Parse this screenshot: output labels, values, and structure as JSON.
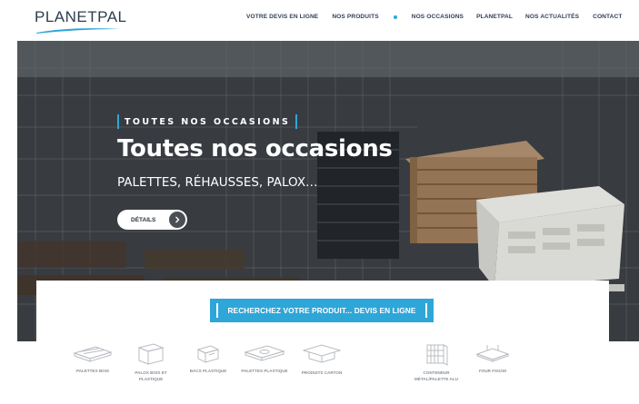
{
  "header": {
    "logo_text": "PLANETPAL",
    "nav": [
      {
        "label": "VOTRE DEVIS EN LIGNE"
      },
      {
        "label": "NOS PRODUITS"
      },
      {
        "label": "NOS OCCASIONS"
      },
      {
        "label": "PLANETPAL"
      },
      {
        "label": "NOS ACTUALITÉS"
      },
      {
        "label": "CONTACT"
      }
    ]
  },
  "hero": {
    "kicker": "TOUTES NOS OCCASIONS",
    "title": "Toutes nos occasions",
    "subtitle": "PALETTES, RÉHAUSSES, PALOX…",
    "button_label": "DÉTAILS",
    "button_icon": "chevron-right-icon"
  },
  "cta": {
    "label": "RECHERCHEZ VOTRE PRODUIT... DEVIS EN LIGNE"
  },
  "products": [
    {
      "label": "PALETTES BOIS",
      "icon": "wood-pallet-icon"
    },
    {
      "label": "PALOX BOIS ET PLASTIQUE",
      "icon": "palox-icon"
    },
    {
      "label": "BACS PLASTIQUE",
      "icon": "plastic-bin-icon"
    },
    {
      "label": "PALETTES PLASTIQUE",
      "icon": "plastic-pallet-icon"
    },
    {
      "label": "PRODUITS CARTON",
      "icon": "cardboard-icon"
    },
    {
      "label": "CONTENEUR MÉTAL/PALETTE ALU",
      "icon": "metal-container-icon"
    },
    {
      "label": "FOUR FSG/30",
      "icon": "oven-tray-icon"
    }
  ],
  "colors": {
    "accent": "#2fa6d8",
    "nav_text": "#33405a",
    "hero_text": "#ffffff"
  }
}
